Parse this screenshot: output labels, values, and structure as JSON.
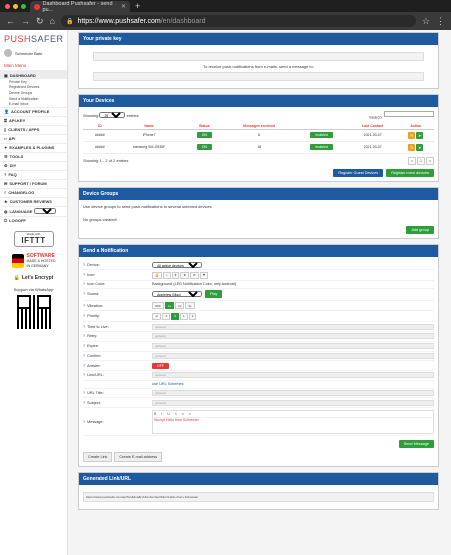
{
  "browser": {
    "tab_title": "Dashboard Pushsafer - send pu...",
    "url_domain": "https://www.pushsafer.com",
    "url_path": "/en/dashboard"
  },
  "sidebar": {
    "logo_left": "PUSH",
    "logo_right": "SAFER",
    "user_name": "Schneider Bahr",
    "main_menu": "Main Menu",
    "items": [
      {
        "label": "DASHBOARD"
      },
      {
        "label": "ACCOUNT PROFILE"
      },
      {
        "label": "API-KEY"
      },
      {
        "label": "CLIENTS / APPS"
      },
      {
        "label": "API"
      },
      {
        "label": "EXAMPLES & PLUGINS"
      },
      {
        "label": "TOOLS"
      },
      {
        "label": "DIY"
      },
      {
        "label": "FAQ"
      },
      {
        "label": "SUPPORT / FORUM"
      },
      {
        "label": "CHANGELOG"
      },
      {
        "label": "CUSTOMER REVIEWS"
      },
      {
        "label": "LANGUAGE"
      },
      {
        "label": "LOGOFF"
      }
    ],
    "dashboard_subs": [
      "Private Key",
      "Registered Devices",
      "Device Groups",
      "Send a Notification",
      "E-mail Inbox"
    ],
    "language_value": "English",
    "ifttt_small": "Made with",
    "ifttt_big": "IFTTT",
    "seal_line1": "SOFTWARE",
    "seal_line2": "MADE & HOSTED",
    "seal_line3": "IN GERMANY",
    "lets_encrypt": "Let's Encrypt",
    "whatsapp": "Support via WhatsApp"
  },
  "private_key": {
    "title": "Your private key",
    "email_text": "To receive push-notifications from e-mails, send a message to:"
  },
  "devices": {
    "title": "Your Devices",
    "show_label": "Showing",
    "show_value": "25",
    "show_suffix": "entries",
    "search_label": "Search:",
    "columns": [
      "",
      "ID",
      "Name",
      "Status",
      "Messages received",
      "",
      "Last Contact",
      "Action"
    ],
    "rows": [
      {
        "id": "#####",
        "name": "iPhone7",
        "status": "ON",
        "messages": "6",
        "state": "enabled",
        "last": "2021-03-07"
      },
      {
        "id": "#####",
        "name": "samsung SM-G935F",
        "status": "ON",
        "messages": "18",
        "state": "enabled",
        "last": "2021-03-07"
      }
    ],
    "info": "Showing 1 - 2 of 2 entries",
    "pager": [
      "<",
      "1",
      ">"
    ],
    "btn_guest": "Register Guest Devices",
    "btn_register": "Register more devices"
  },
  "groups": {
    "title": "Device Groups",
    "desc": "Use device groups to send push-notifications to several selected devices",
    "empty": "No groups created!",
    "add_btn": "Add group"
  },
  "send": {
    "title": "Send a Notification",
    "fields": [
      {
        "label": "Device:",
        "value": "All active devices"
      },
      {
        "label": "Icon:",
        "value": ""
      },
      {
        "label": "Icon Color:",
        "value": "Background (LED Notification Color, only Android)"
      },
      {
        "label": "Sound:",
        "value": "Appleiew (Mac)"
      },
      {
        "label": "Vibration:",
        "value": ""
      },
      {
        "label": "Priority:",
        "value": ""
      },
      {
        "label": "Time to Live:",
        "value": "optional"
      },
      {
        "label": "Retry:",
        "value": "optional"
      },
      {
        "label": "Expire:",
        "value": "optional"
      },
      {
        "label": "Confirm:",
        "value": "optional"
      },
      {
        "label": "Answer:",
        "value": "OFF"
      },
      {
        "label": "Link/URL:",
        "value": "optional"
      },
      {
        "label": "URL Title:",
        "value": "optional"
      },
      {
        "label": "Subject:",
        "value": "optional"
      },
      {
        "label": "Message:",
        "value": ""
      }
    ],
    "play_btn": "Play",
    "vibration_opts": [
      "OFF",
      "1x",
      "2x",
      "3x"
    ],
    "priority_opts": [
      "-2",
      "-1",
      "0",
      "1",
      "2"
    ],
    "url_schemes": "use URL Schemes",
    "message_text": "Stumpf Hello from Schneider",
    "send_btn": "Send Message",
    "create_link": "Create Link",
    "create_email": "Create E-mail address"
  },
  "generated": {
    "title": "Generated Link/URL",
    "url": "https://www.pushsafer.com/api?k=&d=a&i=1&s=&v=&p=0&m=Hello+from+Schneider"
  },
  "colors": {
    "brand": "#e53935",
    "header": "#1e5aa0",
    "green": "#2e9d3a"
  }
}
